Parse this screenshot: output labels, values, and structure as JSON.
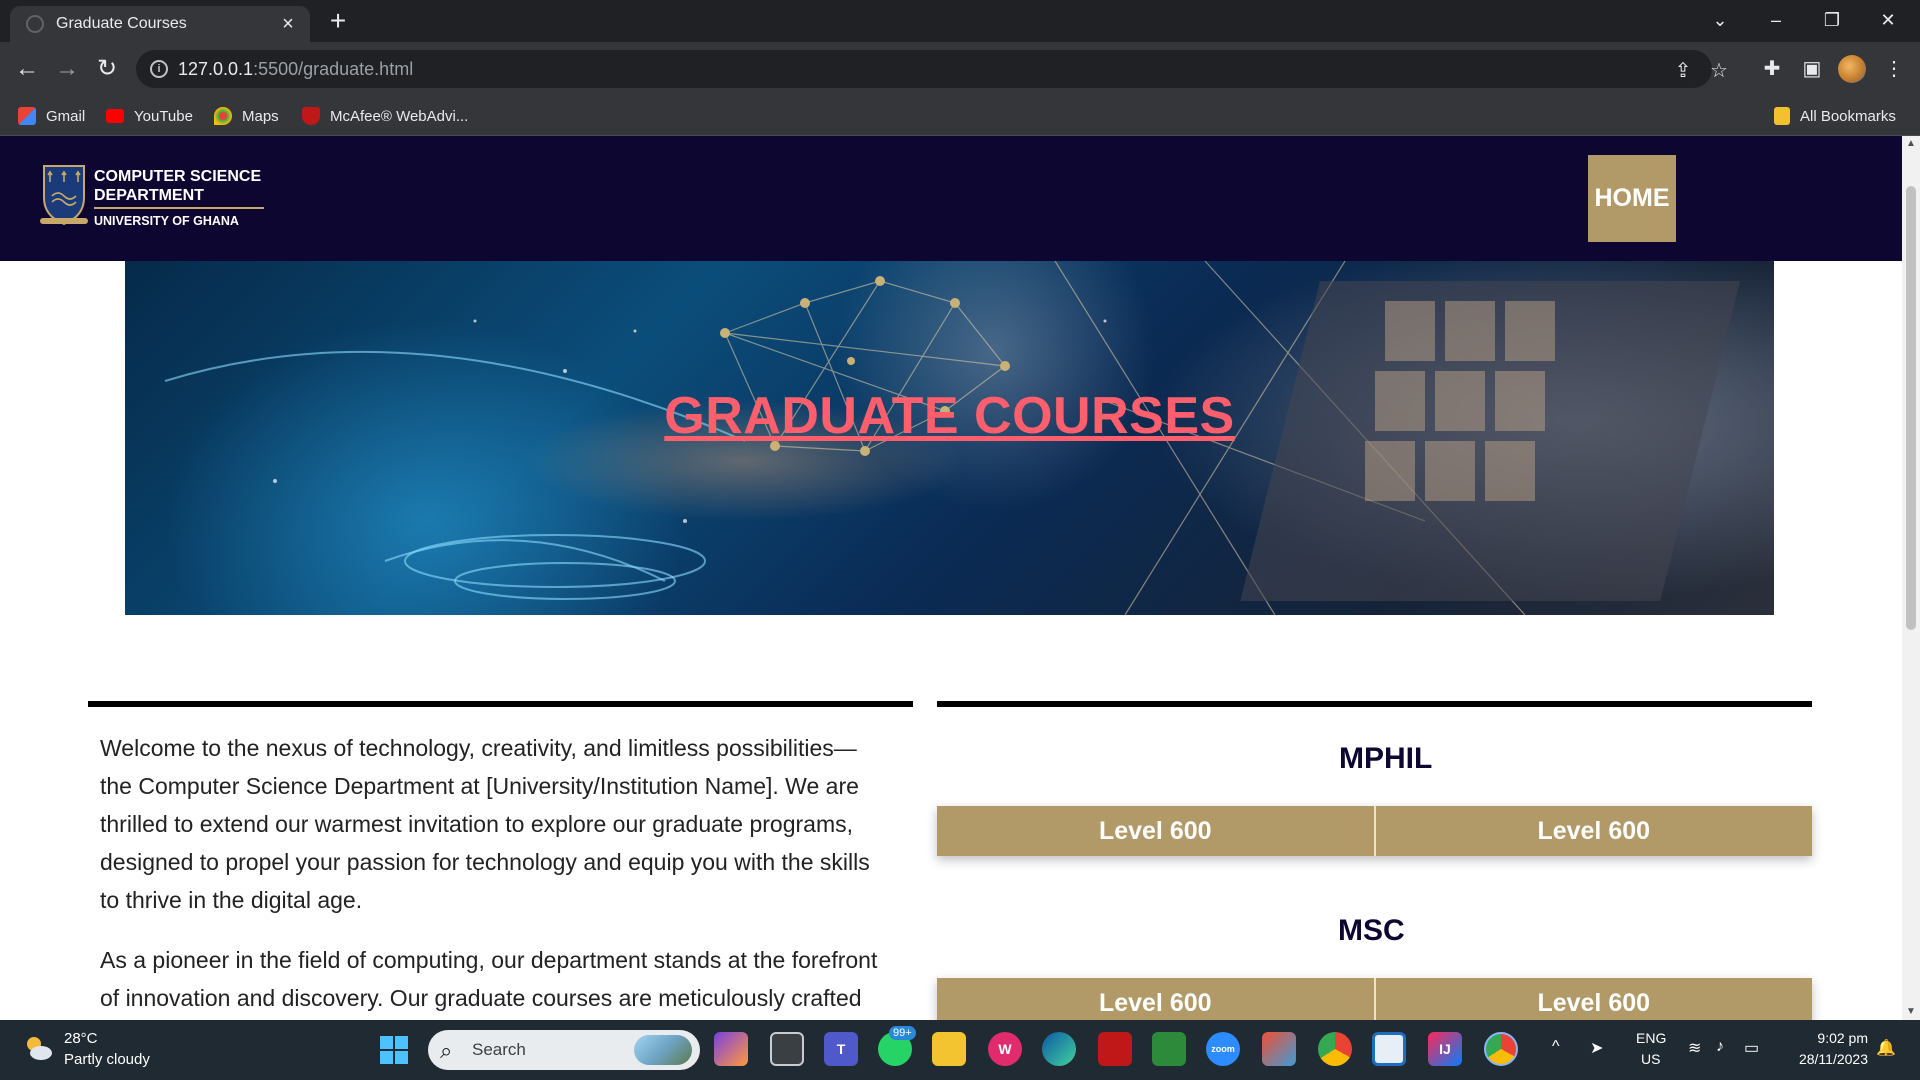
{
  "browser": {
    "tab_title": "Graduate Courses",
    "new_tab_symbol": "+",
    "url_host": "127.0.0.1",
    "url_rest": ":5500/graduate.html",
    "bookmarks": [
      {
        "label": "Gmail",
        "icon": "gmail-icon",
        "color": "#ea4335"
      },
      {
        "label": "YouTube",
        "icon": "youtube-icon",
        "color": "#ff0000"
      },
      {
        "label": "Maps",
        "icon": "maps-icon",
        "color": "#34a853"
      },
      {
        "label": "McAfee® WebAdvi...",
        "icon": "mcafee-icon",
        "color": "#c01818"
      }
    ],
    "all_bookmarks": "All Bookmarks"
  },
  "site": {
    "logo_line1": "COMPUTER SCIENCE",
    "logo_line2": "DEPARTMENT",
    "logo_line3": "UNIVERSITY OF GHANA",
    "home_label": "HOME",
    "hero_title": "GRADUATE COURSES",
    "intro_paragraphs": [
      "Welcome to the nexus of technology, creativity, and limitless possibilities—the Computer Science Department at [University/Institution Name]. We are thrilled to extend our warmest invitation to explore our graduate programs, designed to propel your passion for technology and equip you with the skills to thrive in the digital age.",
      "As a pioneer in the field of computing, our department stands at the forefront of innovation and discovery. Our graduate courses are meticulously crafted"
    ],
    "programs": [
      {
        "title": "MPHIL",
        "levels": [
          "Level 600",
          "Level 600"
        ]
      },
      {
        "title": "MSC",
        "levels": [
          "Level 600",
          "Level 600"
        ]
      }
    ],
    "colors": {
      "header": "#0d0630",
      "gold": "#b19a68",
      "hero_title": "#ff5e6c"
    }
  },
  "taskbar": {
    "temperature": "28°C",
    "weather": "Partly cloudy",
    "search_label": "Search",
    "whatsapp_badge": "99+",
    "lang_line1": "ENG",
    "lang_line2": "US",
    "time": "9:02 pm",
    "date": "28/11/2023"
  }
}
